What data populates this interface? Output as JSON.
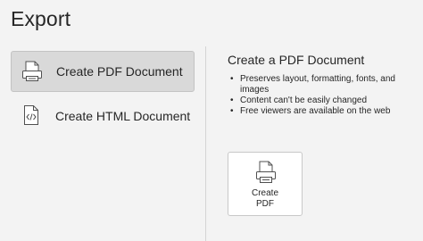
{
  "page": {
    "title": "Export"
  },
  "options": [
    {
      "label": "Create PDF Document",
      "icon": "pdf-document-icon",
      "selected": true
    },
    {
      "label": "Create HTML Document",
      "icon": "html-document-icon",
      "selected": false
    }
  ],
  "details": {
    "title": "Create a PDF Document",
    "bullets": [
      "Preserves layout, formatting, fonts, and images",
      "Content can't be easily changed",
      "Free viewers are available on the web"
    ],
    "action_button": {
      "label": "Create\nPDF",
      "icon": "pdf-document-icon"
    }
  },
  "colors": {
    "background": "#f3f3f3",
    "selected_option": "#d9d9d9",
    "text": "#262626",
    "tile_background": "#ffffff"
  }
}
